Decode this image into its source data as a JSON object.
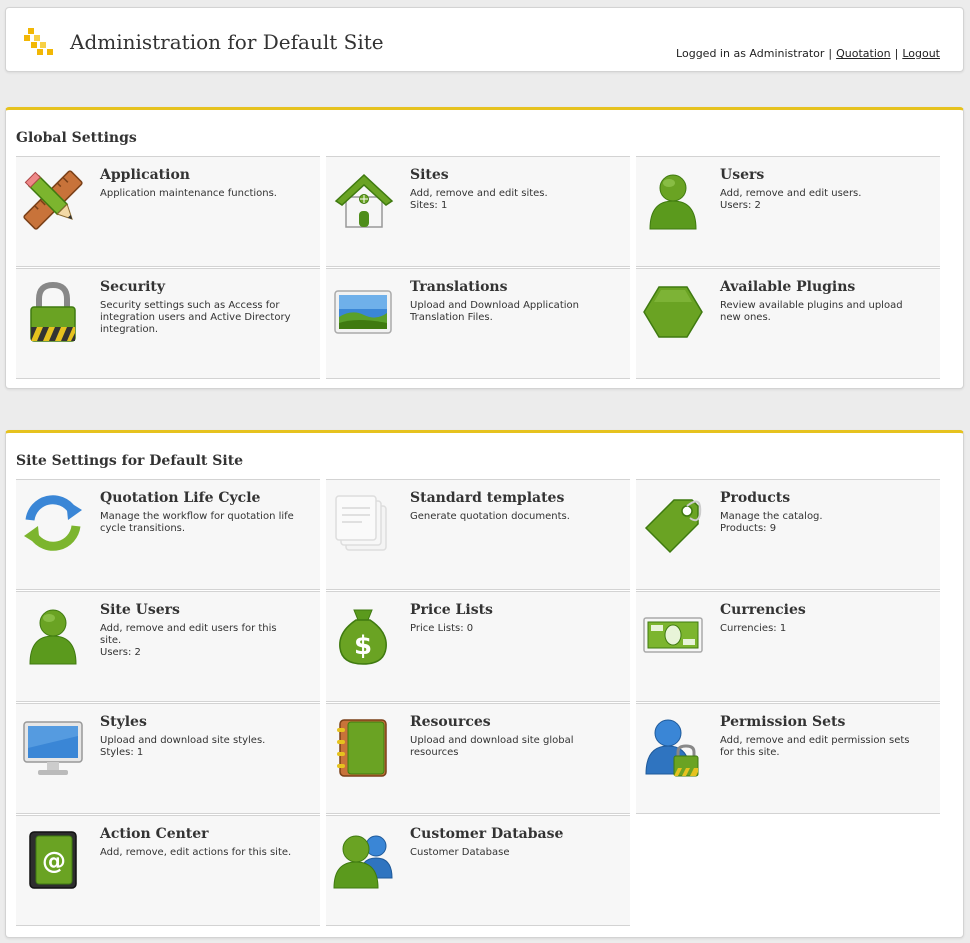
{
  "header": {
    "title": "Administration for Default Site",
    "logged_in_text": "Logged in as Administrator",
    "separator": "|",
    "quotation_link": "Quotation",
    "logout_link": "Logout"
  },
  "global": {
    "heading": "Global Settings",
    "tiles": [
      {
        "name": "Application",
        "desc": "Application maintenance functions.",
        "extra": "",
        "icon": "pencil-ruler-icon"
      },
      {
        "name": "Sites",
        "desc": "Add, remove and edit sites.",
        "extra": "Sites: 1",
        "icon": "house-icon"
      },
      {
        "name": "Users",
        "desc": "Add, remove and edit users.",
        "extra": "Users: 2",
        "icon": "user-icon"
      },
      {
        "name": "Security",
        "desc": "Security settings such as Access for integration users and Active Directory integration.",
        "extra": "",
        "icon": "lock-icon"
      },
      {
        "name": "Translations",
        "desc": "Upload and Download Application Translation Files.",
        "extra": "",
        "icon": "landscape-picture-icon"
      },
      {
        "name": "Available Plugins",
        "desc": "Review available plugins and upload new ones.",
        "extra": "",
        "icon": "hexagon-icon"
      }
    ]
  },
  "site": {
    "heading": "Site Settings for Default Site",
    "tiles": [
      {
        "name": "Quotation Life Cycle",
        "desc": "Manage the workflow for quotation life cycle transitions.",
        "extra": "",
        "icon": "cycle-arrows-icon"
      },
      {
        "name": "Standard templates",
        "desc": "Generate quotation documents.",
        "extra": "",
        "icon": "documents-icon"
      },
      {
        "name": "Products",
        "desc": "Manage the catalog.",
        "extra": "Products: 9",
        "icon": "price-tag-icon"
      },
      {
        "name": "Site Users",
        "desc": "Add, remove and edit users for this site.",
        "extra": "Users: 2",
        "icon": "user-icon"
      },
      {
        "name": "Price Lists",
        "desc": "Price Lists: 0",
        "extra": "",
        "icon": "money-bag-icon"
      },
      {
        "name": "Currencies",
        "desc": "Currencies: 1",
        "extra": "",
        "icon": "banknote-icon"
      },
      {
        "name": "Styles",
        "desc": "Upload and download site styles.",
        "extra": "Styles: 1",
        "icon": "monitor-icon"
      },
      {
        "name": "Resources",
        "desc": "Upload and download site global resources",
        "extra": "",
        "icon": "notebook-icon"
      },
      {
        "name": "Permission Sets",
        "desc": "Add, remove and edit permission sets for this site.",
        "extra": "",
        "icon": "user-lock-icon"
      },
      {
        "name": "Action Center",
        "desc": "Add, remove, edit actions for this site.",
        "extra": "",
        "icon": "email-book-icon"
      },
      {
        "name": "Customer Database",
        "desc": "Customer Database",
        "extra": "",
        "icon": "user-group-icon"
      }
    ]
  },
  "colors": {
    "accent": "#e6c21e",
    "green": "#6aa323",
    "dark_green": "#3f7a10",
    "blue": "#3a86d6"
  }
}
